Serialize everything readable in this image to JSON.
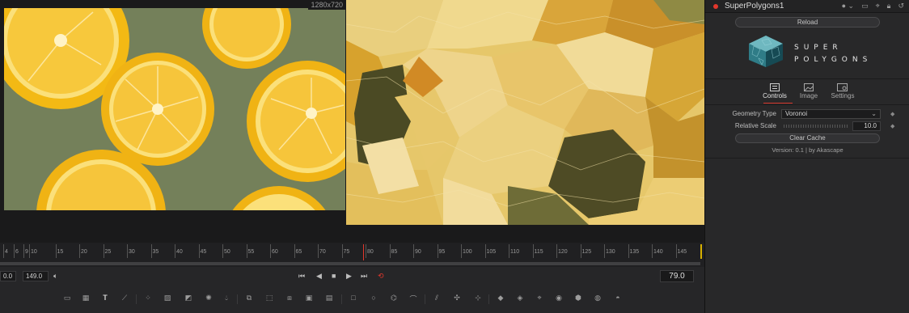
{
  "viewer": {
    "resolution_label": "1280x720"
  },
  "inspector": {
    "node_title": "SuperPolygons1",
    "reload_label": "Reload",
    "logo_line1": "SUPER",
    "logo_line2": "POLYGONS",
    "tabs": [
      {
        "label": "Controls",
        "icon": "sliders-icon",
        "active": true
      },
      {
        "label": "Image",
        "icon": "image-icon",
        "active": false
      },
      {
        "label": "Settings",
        "icon": "settings-icon",
        "active": false
      }
    ],
    "geometry_type": {
      "label": "Geometry Type",
      "value": "Voronoi"
    },
    "relative_scale": {
      "label": "Relative Scale",
      "value": "10.0"
    },
    "clear_cache_label": "Clear Cache",
    "version_text": "Version: 0.1 | by Akascape"
  },
  "timeline": {
    "tick_labels": [
      "4",
      "6",
      "9",
      "10",
      "15",
      "20",
      "25",
      "30",
      "35",
      "40",
      "45",
      "50",
      "55",
      "60",
      "65",
      "70",
      "75",
      "80",
      "85",
      "90",
      "95",
      "100",
      "105",
      "110",
      "115",
      "120",
      "125",
      "130",
      "135",
      "140",
      "145"
    ]
  },
  "transport": {
    "start_value": "0.0",
    "end_value": "149.0",
    "current_frame": "79.0"
  },
  "colors": {
    "accent_red": "#e2372c",
    "end_marker": "#d7b000"
  }
}
